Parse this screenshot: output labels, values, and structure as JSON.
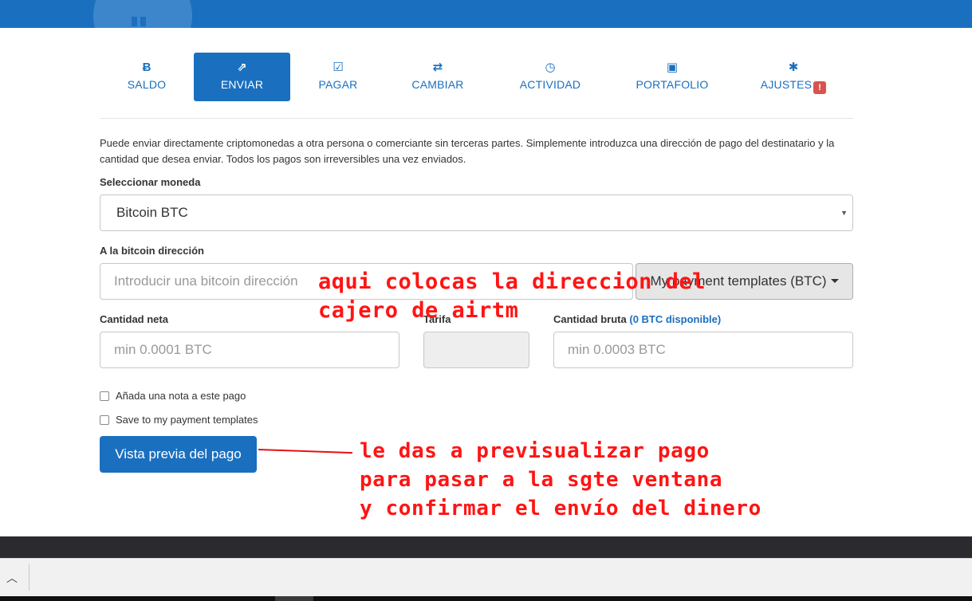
{
  "tabs": [
    {
      "icon": "bitcoin-icon",
      "glyph": "Ƀ",
      "label": "SALDO"
    },
    {
      "icon": "send-icon",
      "glyph": "⇗",
      "label": "ENVIAR"
    },
    {
      "icon": "check-square-icon",
      "glyph": "☑",
      "label": "PAGAR"
    },
    {
      "icon": "exchange-icon",
      "glyph": "⇄",
      "label": "CAMBIAR"
    },
    {
      "icon": "clock-icon",
      "glyph": "◷",
      "label": "ACTIVIDAD"
    },
    {
      "icon": "briefcase-icon",
      "glyph": "▣",
      "label": "PORTAFOLIO"
    },
    {
      "icon": "gear-icon",
      "glyph": "✱",
      "label": "AJUSTES",
      "badge": "!"
    }
  ],
  "active_tab": "ENVIAR",
  "form": {
    "description": "Puede enviar directamente criptomonedas a otra persona o comerciante sin terceras partes. Simplemente introduzca una dirección de pago del destinatario y la cantidad que desea enviar. Todos los pagos son irreversibles una vez enviados.",
    "currency_label": "Seleccionar moneda",
    "currency_value": "Bitcoin BTC",
    "address_label": "A la bitcoin dirección",
    "address_placeholder": "Introducir una bitcoin dirección",
    "templates_button": "My payment templates (BTC)",
    "net_label": "Cantidad neta",
    "net_placeholder": "min 0.0001 BTC",
    "fee_label": "Tarifa",
    "gross_label": "Cantidad bruta",
    "gross_available": "(0 BTC disponible)",
    "gross_placeholder": "min 0.0003 BTC",
    "note_checkbox": "Añada una nota a este pago",
    "save_template_checkbox": "Save to my payment templates",
    "preview_button": "Vista previa del pago"
  },
  "annotations": {
    "address_note": "aqui colocas la direccion del\ncajero de airtm",
    "preview_note": "le das a previsualizar pago\npara pasar a la sgte ventana\ny confirmar el envío del dinero"
  },
  "colors": {
    "brand_blue": "#1a6fbf",
    "annotation_red": "#ff1414",
    "badge_red": "#d9534f"
  }
}
